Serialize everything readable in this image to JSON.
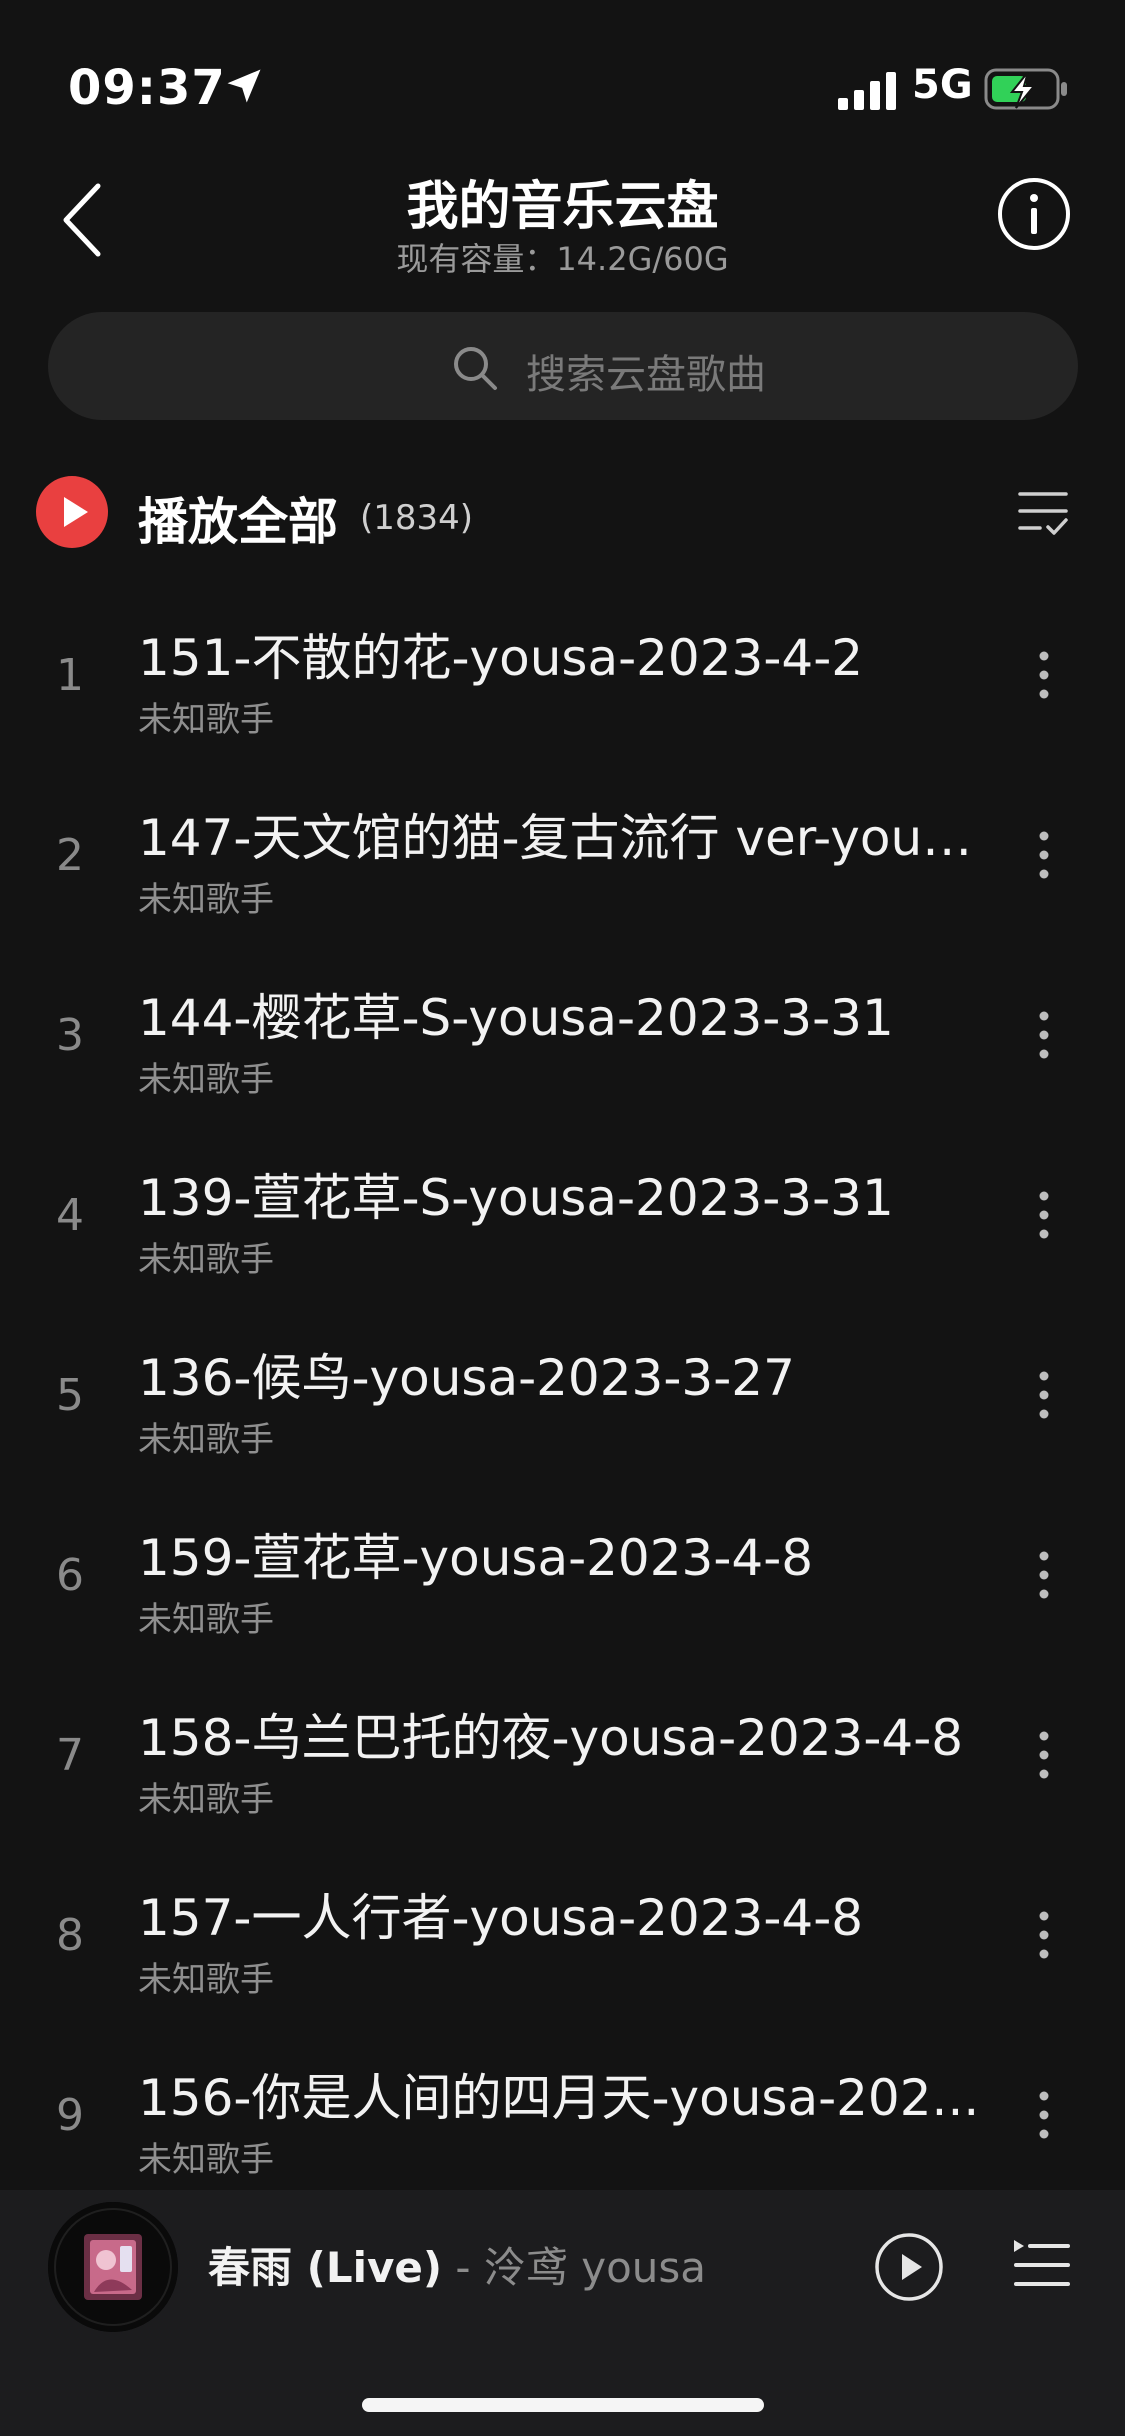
{
  "status_bar": {
    "time": "09:37",
    "network": "5G"
  },
  "header": {
    "title": "我的音乐云盘",
    "subtitle": "现有容量：14.2G/60G"
  },
  "search": {
    "placeholder": "搜索云盘歌曲"
  },
  "play_all": {
    "label": "播放全部",
    "count": "(1834)"
  },
  "songs": [
    {
      "index": "1",
      "title": "151-不散的花-yousa-2023-4-2",
      "artist": "未知歌手"
    },
    {
      "index": "2",
      "title": "147-天文馆的猫-复古流行 ver-yous...",
      "artist": "未知歌手"
    },
    {
      "index": "3",
      "title": "144-樱花草-S-yousa-2023-3-31",
      "artist": "未知歌手"
    },
    {
      "index": "4",
      "title": "139-萱花草-S-yousa-2023-3-31",
      "artist": "未知歌手"
    },
    {
      "index": "5",
      "title": "136-候鸟-yousa-2023-3-27",
      "artist": "未知歌手"
    },
    {
      "index": "6",
      "title": "159-萱花草-yousa-2023-4-8",
      "artist": "未知歌手"
    },
    {
      "index": "7",
      "title": "158-乌兰巴托的夜-yousa-2023-4-8",
      "artist": "未知歌手"
    },
    {
      "index": "8",
      "title": "157-一人行者-yousa-2023-4-8",
      "artist": "未知歌手"
    },
    {
      "index": "9",
      "title": "156-你是人间的四月天-yousa-202...",
      "artist": "未知歌手"
    }
  ],
  "player": {
    "title": "春雨 (Live)",
    "separator": " - ",
    "artist": "泠鸢 yousa"
  },
  "colors": {
    "background": "#131313",
    "accent_red": "#e94040",
    "muted_text": "#8f8f8f"
  }
}
